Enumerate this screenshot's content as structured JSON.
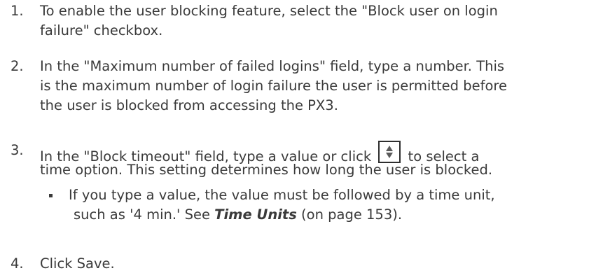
{
  "steps": [
    {
      "number": "1.",
      "lines": [
        "To enable the user blocking feature, select the \"Block user on login",
        "failure\" checkbox."
      ]
    },
    {
      "number": "2.",
      "lines": [
        "In the \"Maximum number of failed logins\" field, type a number. This",
        "is the maximum number of login failure the user is permitted before",
        "the user is blocked from accessing the PX3."
      ]
    },
    {
      "number": "3.",
      "line1_before": "In the \"Block timeout\" field, type a value or click",
      "line1_after": "to select a",
      "line2": "time option. This setting determines how long the user is blocked.",
      "icon": "spinner-up-down-icon",
      "bullet": {
        "line1": "If you type a value, the value must be followed by a time unit,",
        "line2_before": "such as '4 min.' See ",
        "link": "Time Units",
        "line2_after": " (on page 153)."
      }
    },
    {
      "number": "4.",
      "lines": [
        "Click Save."
      ]
    }
  ]
}
